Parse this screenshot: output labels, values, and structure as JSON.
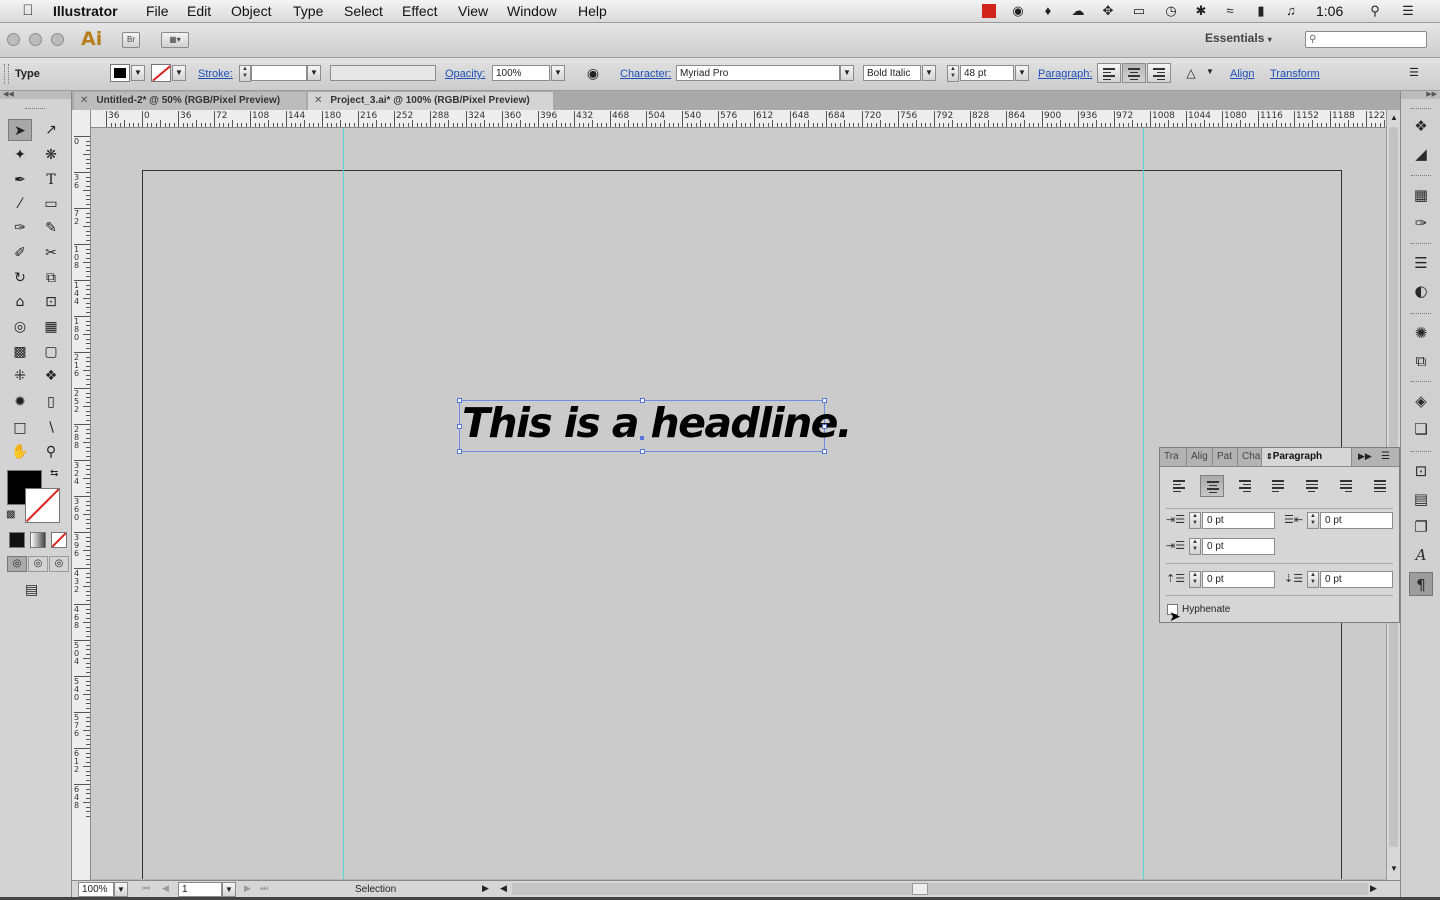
{
  "menubar": {
    "apple": "",
    "app": "Illustrator",
    "items": [
      "File",
      "Edit",
      "Object",
      "Type",
      "Select",
      "Effect",
      "View",
      "Window",
      "Help"
    ],
    "clock": "1:06"
  },
  "appbar": {
    "logo": "Ai",
    "bridge": "Br",
    "workspace": "Essentials",
    "search_placeholder": ""
  },
  "controlbar": {
    "tool_name": "Type",
    "stroke_label": "Stroke:",
    "opacity_label": "Opacity:",
    "opacity_value": "100%",
    "character_label": "Character:",
    "font_family": "Myriad Pro",
    "font_style": "Bold Italic",
    "font_size": "48 pt",
    "paragraph_label": "Paragraph:",
    "align_label": "Align",
    "transform_label": "Transform"
  },
  "tabs": [
    {
      "label": "Untitled-2* @ 50% (RGB/Pixel Preview)",
      "active": false
    },
    {
      "label": "Project_3.ai* @ 100% (RGB/Pixel Preview)",
      "active": true
    }
  ],
  "rulers": {
    "h_labels": [
      "36",
      "0",
      "36",
      "72",
      "108",
      "144",
      "180",
      "216",
      "252",
      "288",
      "324",
      "360",
      "396",
      "432",
      "468",
      "504",
      "540",
      "576",
      "612",
      "648",
      "684",
      "720",
      "756",
      "792",
      "828",
      "864",
      "900",
      "936",
      "972",
      "1008",
      "1044",
      "1080",
      "1116",
      "1152",
      "1188",
      "122"
    ],
    "v_labels": [
      "0",
      "36",
      "72",
      "108",
      "144",
      "180",
      "216",
      "252",
      "288",
      "324",
      "360",
      "396",
      "432",
      "468",
      "504",
      "540",
      "576",
      "612",
      "648"
    ]
  },
  "canvas": {
    "headline": "This is a headline."
  },
  "paragraph_panel": {
    "tabs": [
      "Tra",
      "Alig",
      "Pat",
      "Cha",
      "Paragraph"
    ],
    "left_indent": "0 pt",
    "right_indent": "0 pt",
    "first_line_indent": "0 pt",
    "space_before": "0 pt",
    "space_after": "0 pt",
    "hyphenate_label": "Hyphenate",
    "hyphenate_checked": false
  },
  "statusbar": {
    "zoom": "100%",
    "artboard": "1",
    "tool_status": "Selection"
  },
  "colors": {
    "accent_link": "#1f4fb8",
    "guide": "#5ad3d3",
    "selection": "#6d8fdd"
  }
}
